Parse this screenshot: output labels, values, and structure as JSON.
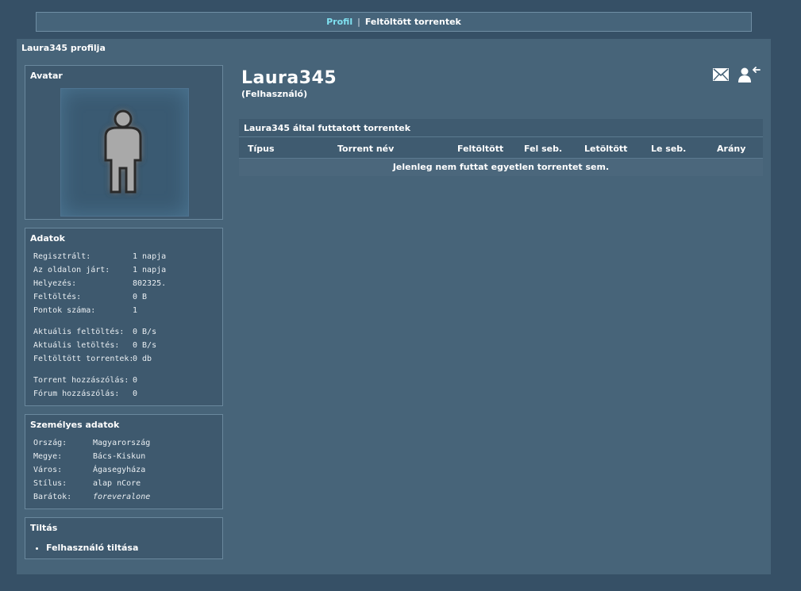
{
  "nav": {
    "profile": "Profil",
    "separator": "|",
    "uploaded": "Feltöltött torrentek"
  },
  "main_title": "Laura345 profilja",
  "avatar_box": {
    "title": "Avatar"
  },
  "data_box": {
    "title": "Adatok",
    "rows": [
      {
        "label": "Regisztrált:",
        "value": "1 napja"
      },
      {
        "label": "Az oldalon járt:",
        "value": "1 napja"
      },
      {
        "label": "Helyezés:",
        "value": "802325."
      },
      {
        "label": "Feltöltés:",
        "value": "0 B"
      },
      {
        "label": "Pontok száma:",
        "value": "1"
      },
      {
        "label": "Aktuális feltöltés:",
        "value": "0 B/s"
      },
      {
        "label": "Aktuális letöltés:",
        "value": "0 B/s"
      },
      {
        "label": "Feltöltött torrentek:",
        "value": "0 db"
      },
      {
        "label": "Torrent hozzászólás:",
        "value": "0"
      },
      {
        "label": "Fórum hozzászólás:",
        "value": "0"
      }
    ]
  },
  "personal_box": {
    "title": "Személyes adatok",
    "rows": [
      {
        "label": "Ország:",
        "value": "Magyarország"
      },
      {
        "label": "Megye:",
        "value": "Bács-Kiskun"
      },
      {
        "label": "Város:",
        "value": "Ágasegyháza"
      },
      {
        "label": "Stílus:",
        "value": "alap nCore"
      },
      {
        "label": "Barátok:",
        "value": "foreveralone"
      }
    ]
  },
  "ban_box": {
    "title": "Tiltás",
    "items": [
      "Felhasználó tiltása"
    ]
  },
  "profile": {
    "username": "Laura345",
    "role": "(Felhasználó)"
  },
  "icons": {
    "message": "envelope-icon",
    "friend": "add-friend-icon"
  },
  "torrents": {
    "title": "Laura345 által futtatott torrentek",
    "columns": [
      "Típus",
      "Torrent név",
      "Feltöltött",
      "Fel seb.",
      "Letöltött",
      "Le seb.",
      "Arány"
    ],
    "empty": "Jelenleg nem futtat egyetlen torrentet sem."
  }
}
